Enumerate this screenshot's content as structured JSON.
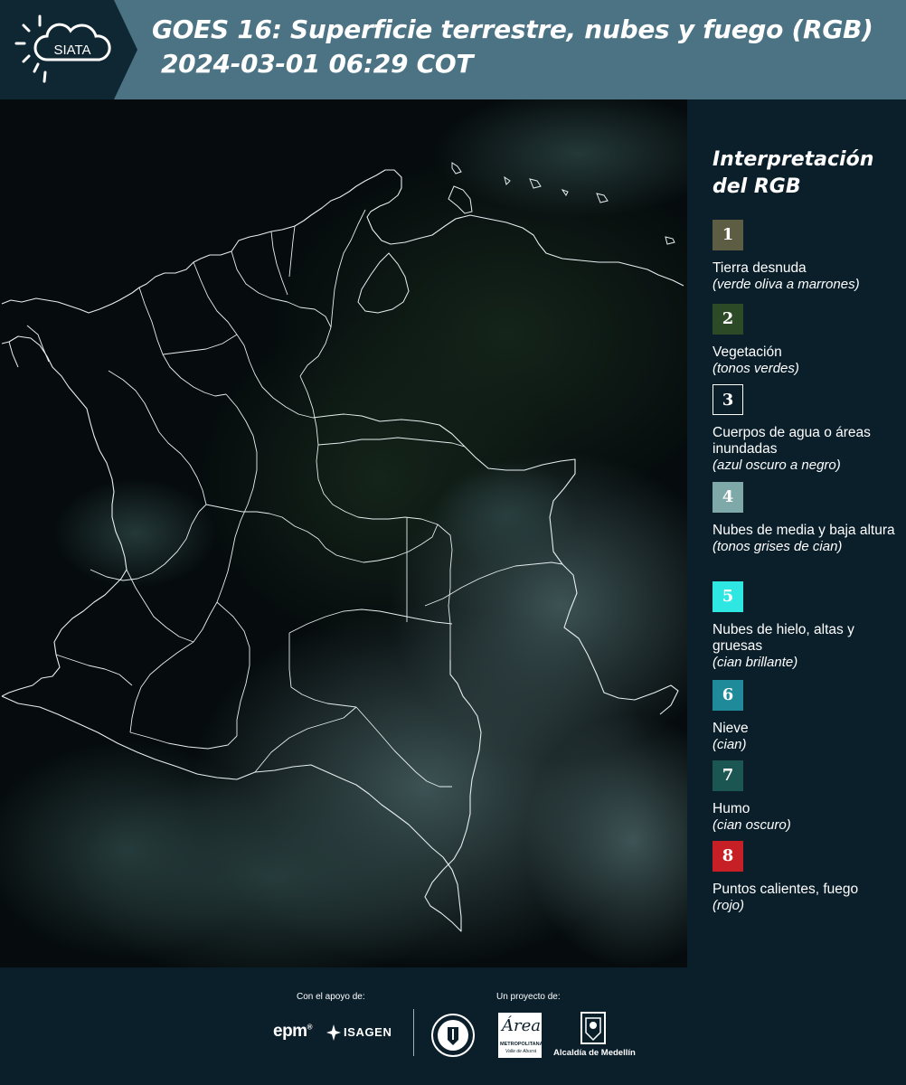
{
  "header": {
    "logo_text": "SIATA",
    "title_line1": "GOES 16: Superficie terrestre, nubes y fuego (RGB)",
    "title_line2": "2024-03-01 06:29 COT"
  },
  "legend": {
    "title_line1": "Interpretación",
    "title_line2": "del RGB",
    "items": [
      {
        "num": "1",
        "label": "Tierra desnuda",
        "sub": "(verde oliva a marrones)",
        "color": "#5c5d43"
      },
      {
        "num": "2",
        "label": "Vegetación",
        "sub": "(tonos verdes)",
        "color": "#2c4a26"
      },
      {
        "num": "3",
        "label": "Cuerpos de agua o áreas inundadas",
        "sub": "(azul oscuro a negro)",
        "color": "#0b1f2b"
      },
      {
        "num": "4",
        "label": "Nubes de media y baja altura",
        "sub": "(tonos grises de cian)",
        "color": "#7fa9a8"
      },
      {
        "num": "5",
        "label": "Nubes de hielo, altas y gruesas",
        "sub": "(cian brillante)",
        "color": "#2ee6e2"
      },
      {
        "num": "6",
        "label": "Nieve",
        "sub": "(cian)",
        "color": "#1f8a99"
      },
      {
        "num": "7",
        "label": "Humo",
        "sub": "(cian oscuro)",
        "color": "#1b5652"
      },
      {
        "num": "8",
        "label": "Puntos calientes, fuego",
        "sub": "(rojo)",
        "color": "#c61f25"
      }
    ]
  },
  "footer": {
    "support_label": "Con el apoyo de:",
    "project_label": "Un proyecto de:",
    "sponsors": {
      "epm": "epm",
      "isagen": "ISAGEN",
      "area_name": "Área",
      "area_sub": "METROPOLITANA",
      "area_sub2": "Valle de Aburrá",
      "alcaldia": "Alcaldía de Medellín"
    }
  }
}
